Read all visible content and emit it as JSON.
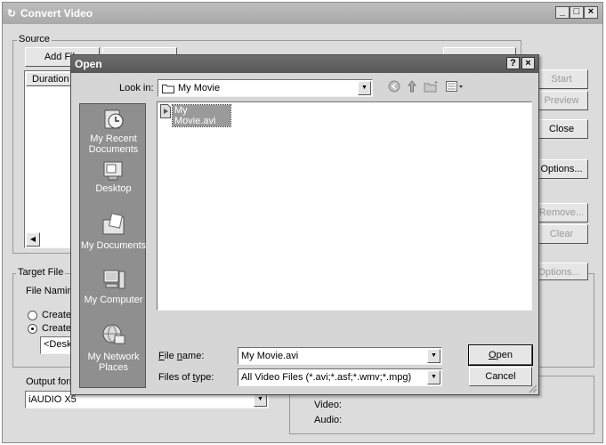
{
  "main_window": {
    "title": "Convert Video",
    "caption_buttons": {
      "minimize": "_",
      "maximize": "□",
      "close": "×"
    },
    "source_group": {
      "label": "Source",
      "add_files_button": "Add File",
      "column_header": "Duration"
    },
    "right_buttons": {
      "start": "Start",
      "preview": "Preview",
      "close": "Close",
      "options": "Options...",
      "remove": "Remove...",
      "clear": "Clear",
      "options2": "Options..."
    },
    "target_file_group": {
      "label": "Target File",
      "file_naming_label": "File Naming",
      "radio_create_1": "Create",
      "radio_create_2": "Create",
      "folder_value": "<Desk"
    },
    "output_format": {
      "label": "Output form",
      "value": "iAUDIO X5"
    },
    "info_panel": {
      "video_label": "Video:",
      "audio_label": "Audio:"
    }
  },
  "open_dialog": {
    "title": "Open",
    "caption_buttons": {
      "help": "?",
      "close": "×"
    },
    "look_in_label": "Look in:",
    "look_in_value": "My Movie",
    "places": [
      {
        "label": "My Recent Documents"
      },
      {
        "label": "Desktop"
      },
      {
        "label": "My Documents"
      },
      {
        "label": "My Computer"
      },
      {
        "label": "My Network Places"
      }
    ],
    "files": [
      {
        "name": "My Movie.avi"
      }
    ],
    "file_name_label": "File name:",
    "file_name_value": "My Movie.avi",
    "file_type_label": "Files of type:",
    "file_type_value": "All Video Files (*.avi;*.asf;*.wmv;*.mpg)",
    "open_button": "Open",
    "cancel_button": "Cancel"
  }
}
